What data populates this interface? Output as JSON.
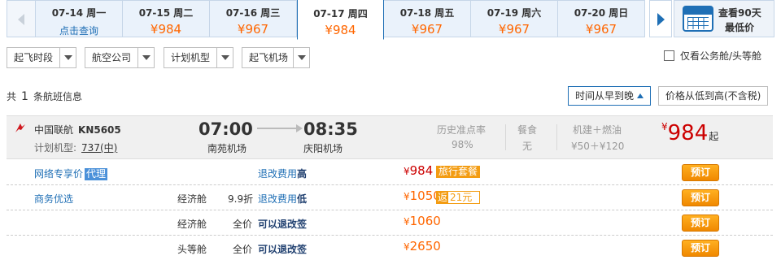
{
  "dates": [
    {
      "date": "07-14",
      "day": "周一",
      "price": "点击查询",
      "link": true
    },
    {
      "date": "07-15",
      "day": "周二",
      "price": "¥984"
    },
    {
      "date": "07-16",
      "day": "周三",
      "price": "¥967"
    },
    {
      "date": "07-17",
      "day": "周四",
      "price": "¥984",
      "active": true
    },
    {
      "date": "07-18",
      "day": "周五",
      "price": "¥967"
    },
    {
      "date": "07-19",
      "day": "周六",
      "price": "¥967"
    },
    {
      "date": "07-20",
      "day": "周日",
      "price": "¥967"
    }
  ],
  "ninety": {
    "line1": "查看90天",
    "line2": "最低价"
  },
  "filters": [
    "起飞时段",
    "航空公司",
    "计划机型",
    "起飞机场"
  ],
  "checkbox_label": "仅看公务舱/头等舱",
  "summary": {
    "prefix": "共",
    "count": "1",
    "suffix": "条航班信息"
  },
  "sort": {
    "time": "时间从早到晚",
    "price": "价格从低到高(不含税)"
  },
  "flight": {
    "airline": "中国联航",
    "flight_no": "KN5605",
    "plane_label": "计划机型:",
    "plane": "737(中)",
    "dep_time": "07:00",
    "dep_airport": "南苑机场",
    "arr_time": "08:35",
    "arr_airport": "庆阳机场",
    "ontime_label": "历史准点率",
    "ontime": "98%",
    "meal_label": "餐食",
    "meal": "无",
    "tax_label": "机建＋燃油",
    "tax": "¥50＋¥120",
    "price_cur": "¥",
    "price": "984",
    "price_suffix": "起",
    "logo_color": "#d0181e"
  },
  "fares": [
    {
      "name": "网络专享价",
      "tag": "代理",
      "cabin": "",
      "discount": "",
      "policy_pre": "退改费用",
      "policy_bold": "高",
      "cur": "¥",
      "price": "984",
      "badge": "旅行套餐",
      "book": "预订"
    },
    {
      "name": "商务优选",
      "tag": "",
      "cabin": "经济舱",
      "discount": "9.9折",
      "policy_pre": "退改费用",
      "policy_bold": "低",
      "cur": "¥",
      "price": "1050",
      "fan1": "返",
      "fan2": "21元",
      "book": "预订"
    },
    {
      "name": "",
      "tag": "",
      "cabin": "经济舱",
      "discount": "全价",
      "policy_pre": "",
      "policy_bold": "可以退改签",
      "cur": "¥",
      "price": "1060",
      "book": "预订"
    },
    {
      "name": "",
      "tag": "",
      "cabin": "头等舱",
      "discount": "全价",
      "policy_pre": "",
      "policy_bold": "可以退改签",
      "cur": "¥",
      "price": "2650",
      "book": "预订"
    }
  ]
}
